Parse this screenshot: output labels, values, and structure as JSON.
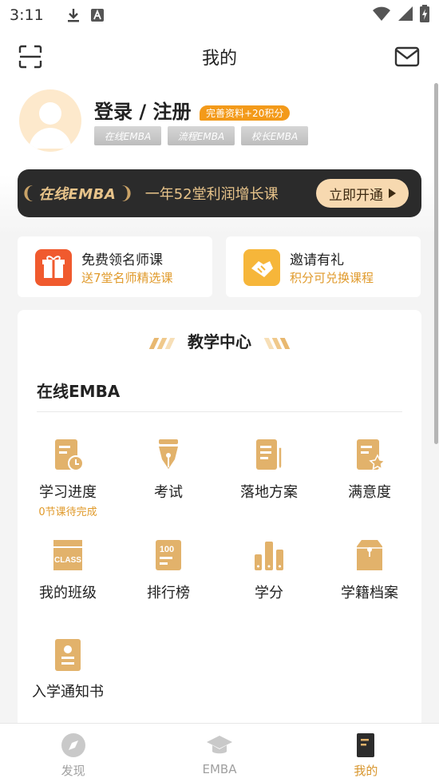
{
  "status_bar": {
    "time": "3:11"
  },
  "header": {
    "title": "我的"
  },
  "profile": {
    "login_text": "登录 / 注册",
    "reward_badge": "完善资料+20积分",
    "tags": [
      "在线EMBA",
      "流程EMBA",
      "校长EMBA"
    ]
  },
  "banner": {
    "brand": "在线EMBA",
    "text": "一年52堂利润增长课",
    "button": "立即开通"
  },
  "promos": [
    {
      "title": "免费领名师课",
      "subtitle": "送7堂名师精选课",
      "icon": "gift-icon",
      "color": "#f05a2e"
    },
    {
      "title": "邀请有礼",
      "subtitle": "积分可兑换课程",
      "icon": "handshake-icon",
      "color": "#f6b63a"
    }
  ],
  "teaching_center": {
    "title": "教学中心",
    "section_title": "在线EMBA",
    "items": [
      {
        "label": "学习进度",
        "sub": "0节课待完成",
        "icon": "progress-icon"
      },
      {
        "label": "考试",
        "sub": "",
        "icon": "pen-icon"
      },
      {
        "label": "落地方案",
        "sub": "",
        "icon": "plan-icon"
      },
      {
        "label": "满意度",
        "sub": "",
        "icon": "star-doc-icon"
      },
      {
        "label": "我的班级",
        "sub": "",
        "icon": "class-icon",
        "icon_text": "CLASS"
      },
      {
        "label": "排行榜",
        "sub": "",
        "icon": "ranking-icon",
        "icon_text": "100"
      },
      {
        "label": "学分",
        "sub": "",
        "icon": "credits-icon"
      },
      {
        "label": "学籍档案",
        "sub": "",
        "icon": "archive-icon"
      },
      {
        "label": "入学通知书",
        "sub": "",
        "icon": "admission-icon"
      }
    ]
  },
  "tabbar": {
    "items": [
      {
        "label": "发现",
        "icon": "compass-icon",
        "active": false
      },
      {
        "label": "EMBA",
        "icon": "graduation-cap-icon",
        "active": false
      },
      {
        "label": "我的",
        "icon": "book-icon",
        "active": true
      }
    ]
  },
  "colors": {
    "accent": "#d8962e",
    "gold_icon": "#e2b26b",
    "banner_bg": "#2b2b2b"
  }
}
